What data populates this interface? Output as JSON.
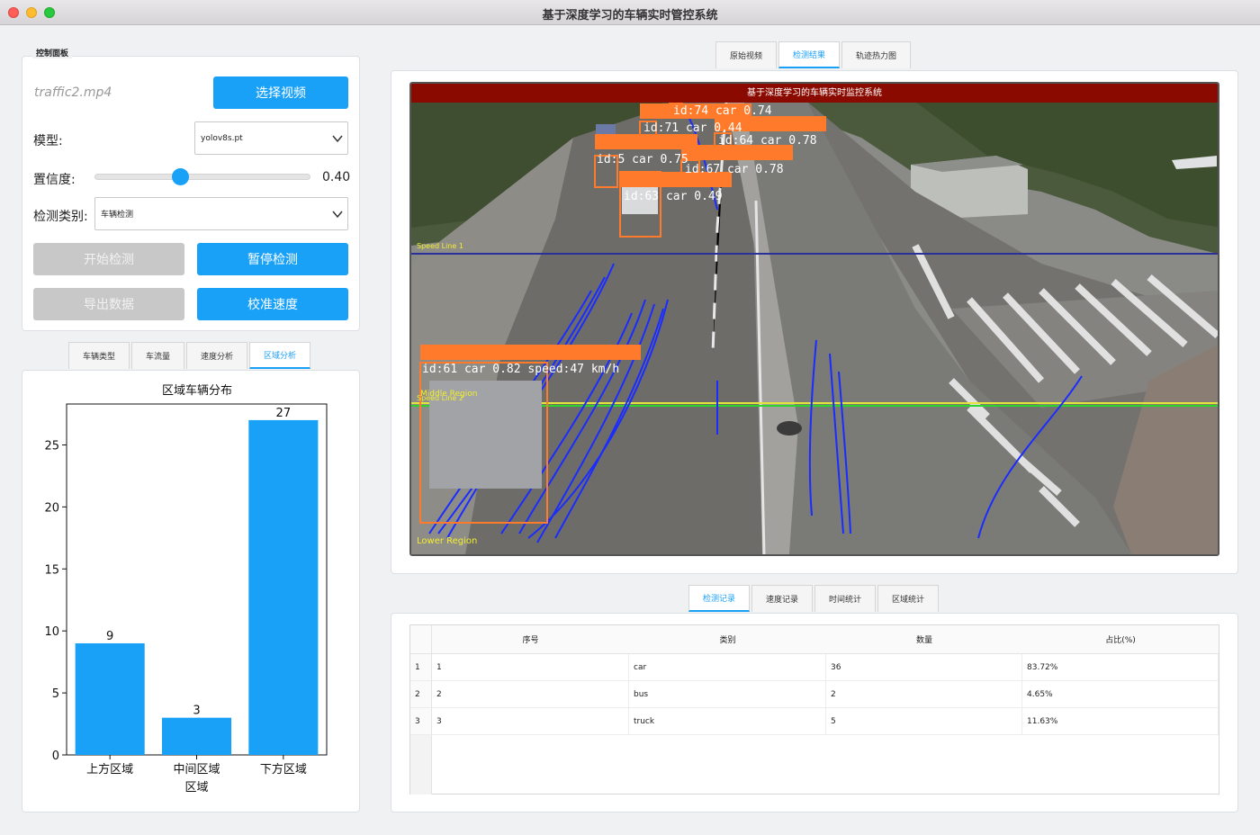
{
  "window": {
    "title": "基于深度学习的车辆实时管控系统"
  },
  "control_panel": {
    "title": "控制面板",
    "file_name": "traffic2.mp4",
    "select_video_label": "选择视频",
    "model_label": "模型:",
    "model_value": "yolov8s.pt",
    "confidence_label": "置信度:",
    "confidence_value": "0.40",
    "confidence_fraction": 0.4,
    "category_label": "检测类别:",
    "category_value": "车辆检测",
    "start_label": "开始检测",
    "pause_label": "暂停检测",
    "export_label": "导出数据",
    "calibrate_label": "校准速度"
  },
  "analysis_tabs": [
    "车辆类型",
    "车流量",
    "速度分析",
    "区域分析"
  ],
  "analysis_active_tab": 3,
  "video_tabs": [
    "原始视频",
    "检测结果",
    "轨迹热力图"
  ],
  "video_active_tab": 1,
  "video": {
    "header": "基于深度学习的车辆实时监控系统",
    "labels": {
      "speed_line_top": "Speed Line 1",
      "middle_region": "Middle Region",
      "speed_line_bottom": "Speed Line 2",
      "lower_region": "Lower Region"
    },
    "detections": [
      "id:74 car 0.74",
      "id:71 car 0.44",
      "id:64 car 0.78",
      "id:5 car 0.75",
      "id:67 car 0.78",
      "id:63 car 0.49",
      "id:61 car 0.82 speed:47 km/h"
    ]
  },
  "record_tabs": [
    "检测记录",
    "速度记录",
    "时间统计",
    "区域统计"
  ],
  "record_active_tab": 0,
  "table": {
    "headers": [
      "序号",
      "类别",
      "数量",
      "占比(%)"
    ],
    "rows": [
      {
        "row_no": "1",
        "cells": [
          "1",
          "car",
          "36",
          "83.72%"
        ]
      },
      {
        "row_no": "2",
        "cells": [
          "2",
          "bus",
          "2",
          "4.65%"
        ]
      },
      {
        "row_no": "3",
        "cells": [
          "3",
          "truck",
          "5",
          "11.63%"
        ]
      }
    ]
  },
  "chart_data": {
    "type": "bar",
    "title": "区域车辆分布",
    "categories": [
      "上方区域",
      "中间区域",
      "下方区域"
    ],
    "values": [
      9,
      3,
      27
    ],
    "data_labels": [
      "9",
      "3",
      "27"
    ],
    "yticks": [
      "0",
      "5",
      "10",
      "15",
      "20",
      "25"
    ],
    "ylim": [
      0,
      28.3
    ],
    "color": "#19a0f7",
    "grid": false,
    "xlabel": "",
    "ylabel": ""
  }
}
